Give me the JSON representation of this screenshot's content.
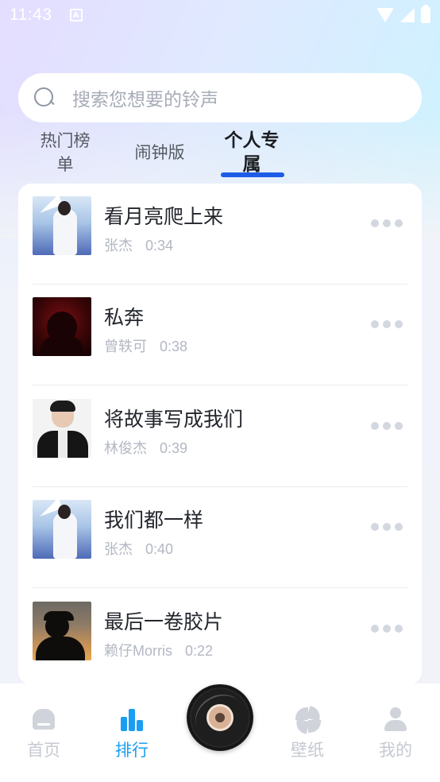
{
  "status_bar": {
    "time": "11:43",
    "notification_glyph": "A"
  },
  "search": {
    "placeholder": "搜索您想要的铃声"
  },
  "tabs": [
    {
      "label": "热门榜单",
      "active": false
    },
    {
      "label": "闹钟版",
      "active": false
    },
    {
      "label": "个人专属",
      "active": true
    }
  ],
  "songs": [
    {
      "title": "看月亮爬上来",
      "artist": "张杰",
      "duration": "0:34"
    },
    {
      "title": "私奔",
      "artist": "曾轶可",
      "duration": "0:38"
    },
    {
      "title": "将故事写成我们",
      "artist": "林俊杰",
      "duration": "0:39"
    },
    {
      "title": "我们都一样",
      "artist": "张杰",
      "duration": "0:40"
    },
    {
      "title": "最后一卷胶片",
      "artist": "赖仔Morris",
      "duration": "0:22"
    }
  ],
  "bottom_nav": [
    {
      "label": "首页",
      "icon": "home-icon",
      "active": false
    },
    {
      "label": "排行",
      "icon": "chart-bars-icon",
      "active": true
    },
    {
      "label": "壁纸",
      "icon": "pinwheel-icon",
      "active": false
    },
    {
      "label": "我的",
      "icon": "user-icon",
      "active": false
    }
  ],
  "center_button": {
    "icon": "vinyl-disc-icon"
  },
  "colors": {
    "accent": "#1a9ef2",
    "tab_underline": "#1e5be6",
    "muted_text": "#b2b7c2"
  }
}
